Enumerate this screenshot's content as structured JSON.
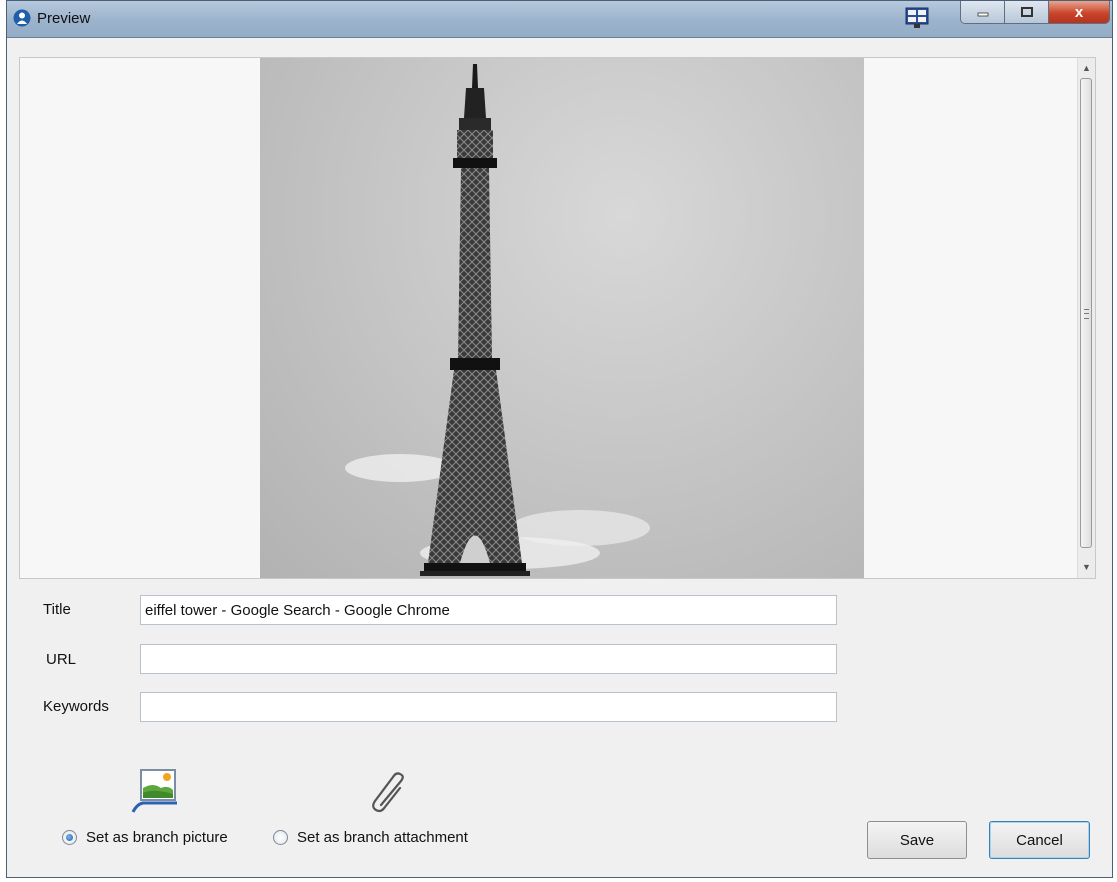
{
  "window": {
    "title": "Preview",
    "close_glyph": "x"
  },
  "icons": {
    "app": "person-icon",
    "layout": "layout-grid-icon",
    "picture": "picture-icon",
    "attachment": "paperclip-icon"
  },
  "form": {
    "title_label": "Title",
    "title_value": "eiffel tower - Google Search - Google Chrome",
    "url_label": "URL",
    "url_value": "",
    "keywords_label": "Keywords",
    "keywords_value": ""
  },
  "options": {
    "picture_label": "Set as branch picture",
    "attachment_label": "Set as branch attachment",
    "selected": "picture"
  },
  "buttons": {
    "save": "Save",
    "cancel": "Cancel"
  },
  "colors": {
    "titlebar": "#9cb3cc",
    "close": "#c9452b",
    "default_button_border": "#3c7fb1"
  }
}
